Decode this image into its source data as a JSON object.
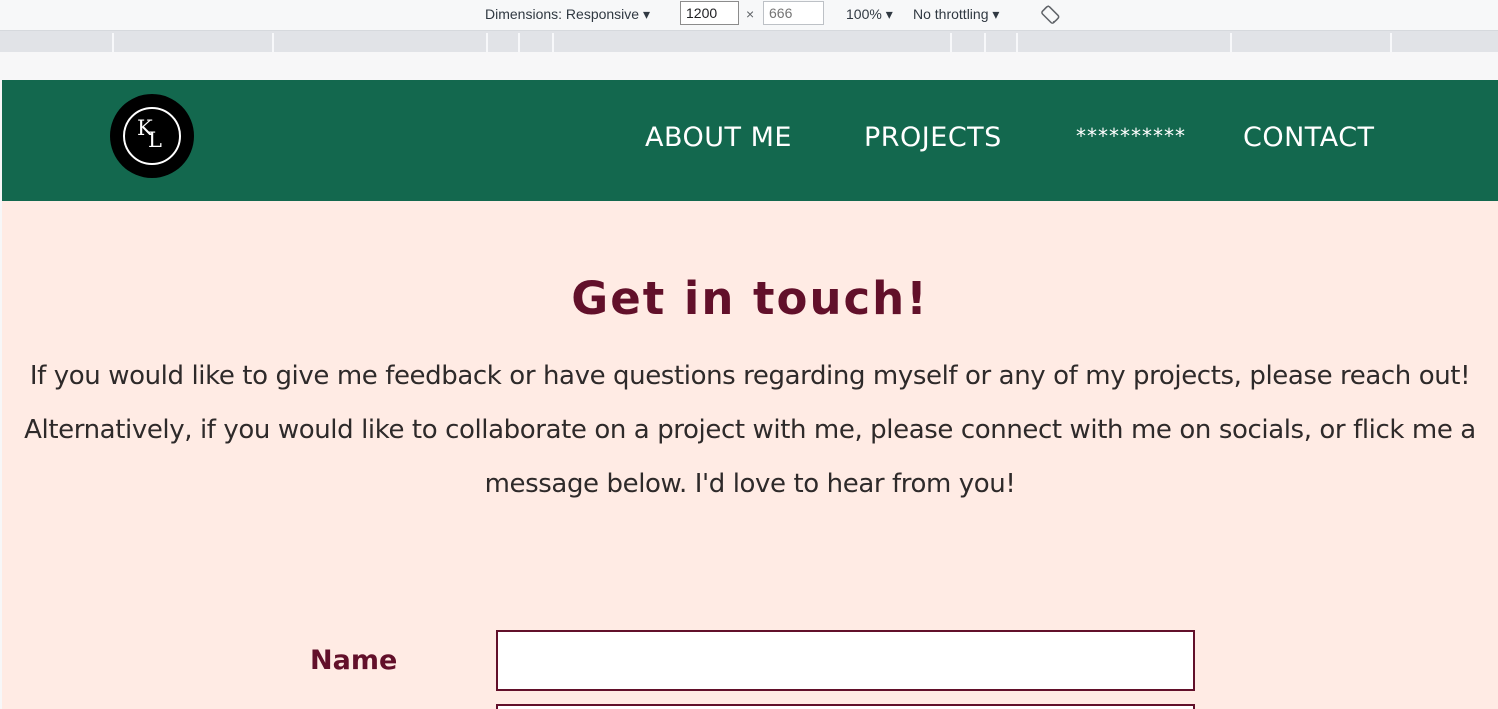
{
  "devtools": {
    "dimensions_label": "Dimensions: Responsive ▾",
    "width_value": "1200",
    "height_placeholder": "666",
    "times": "×",
    "zoom_label": "100% ▾",
    "throttle_label": "No throttling ▾",
    "rotate_icon": "rotate-icon"
  },
  "nav": {
    "logo_initial_1": "K",
    "logo_initial_2": "L",
    "items": [
      "ABOUT ME",
      "PROJECTS",
      "**********",
      "CONTACT"
    ]
  },
  "contact": {
    "heading": "Get in touch!",
    "paragraph_1": "If you would like to give me feedback or have questions regarding myself or any of my projects, please reach out!",
    "paragraph_2": "Alternatively, if you would like to collaborate on a project with me, please connect with me on socials, or flick me a message below. I'd love to hear from you!",
    "name_label": "Name",
    "name_value": ""
  },
  "colors": {
    "nav_green": "#13684e",
    "page_bg": "#ffebe4",
    "heading_maroon": "#62102a"
  }
}
